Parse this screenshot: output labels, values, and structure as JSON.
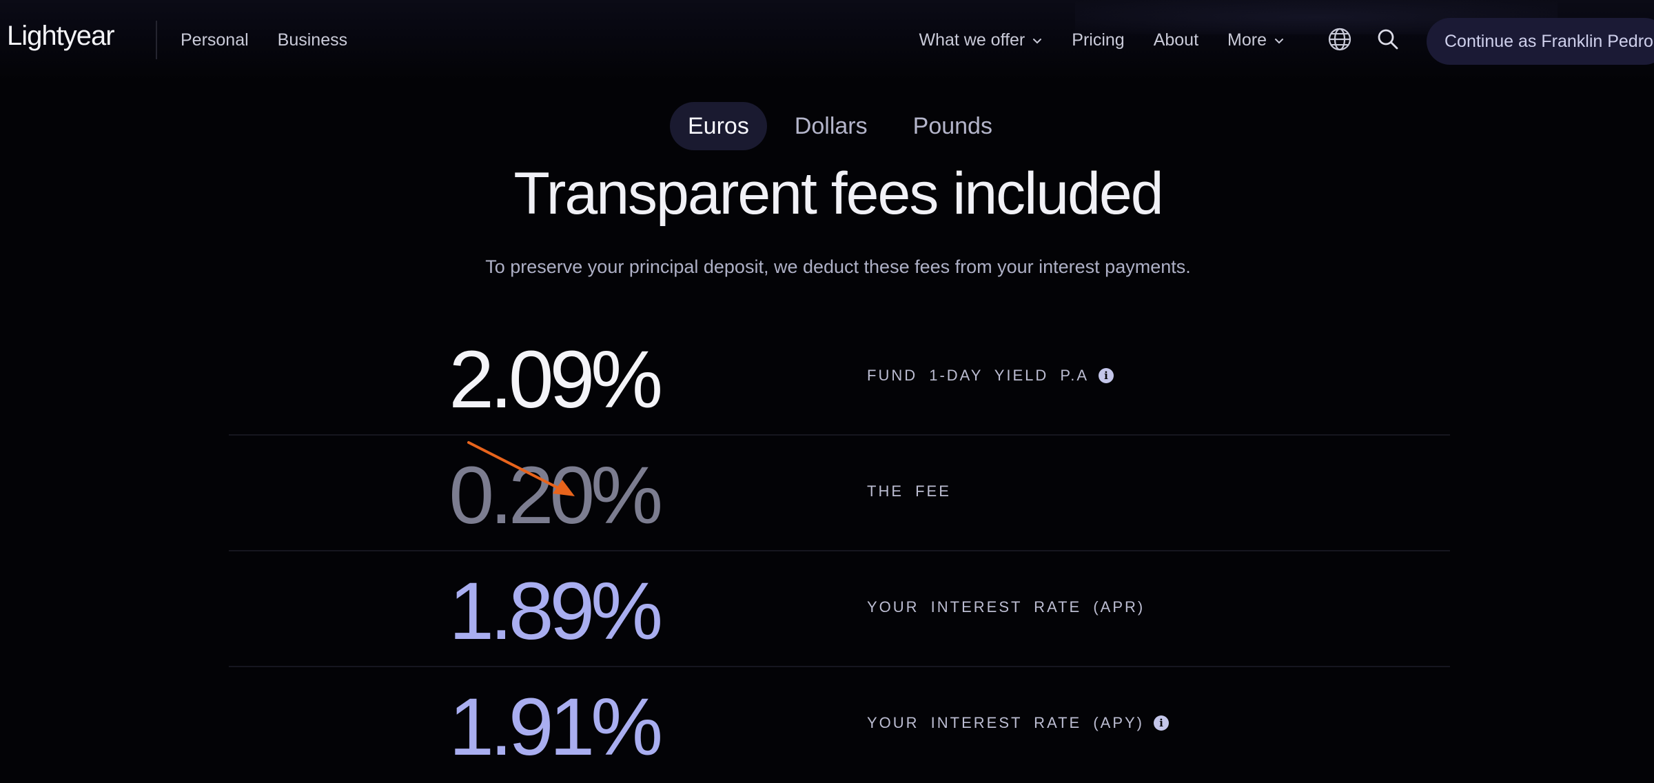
{
  "brand": {
    "logo_text": "Lightyear"
  },
  "nav": {
    "left": [
      "Personal",
      "Business"
    ],
    "right": [
      {
        "label": "What we offer",
        "dropdown": true
      },
      {
        "label": "Pricing",
        "dropdown": false
      },
      {
        "label": "About",
        "dropdown": false
      },
      {
        "label": "More",
        "dropdown": true
      }
    ],
    "icons": [
      "globe-icon",
      "search-icon"
    ],
    "cta_label": "Continue as Franklin Pedro"
  },
  "currency_tabs": {
    "items": [
      "Euros",
      "Dollars",
      "Pounds"
    ],
    "active": "Euros"
  },
  "hero": {
    "title": "Transparent fees included",
    "subtitle": "To preserve your principal deposit, we deduct these fees from your interest payments."
  },
  "rates": [
    {
      "value": "2.09%",
      "label": "FUND 1-DAY YIELD P.A",
      "info": true,
      "color": "#f4f4f8"
    },
    {
      "value": "0.20%",
      "label": "THE FEE",
      "info": false,
      "color": "#7c7d90"
    },
    {
      "value": "1.89%",
      "label": "YOUR INTEREST RATE (APR)",
      "info": false,
      "color": "#a9aef0"
    },
    {
      "value": "1.91%",
      "label": "YOUR INTEREST RATE (APY)",
      "info": true,
      "color": "#a9aef0"
    }
  ],
  "colors": {
    "background": "#030306",
    "cta_bg": "#1b1a35",
    "annotation_arrow": "#e8641c"
  }
}
